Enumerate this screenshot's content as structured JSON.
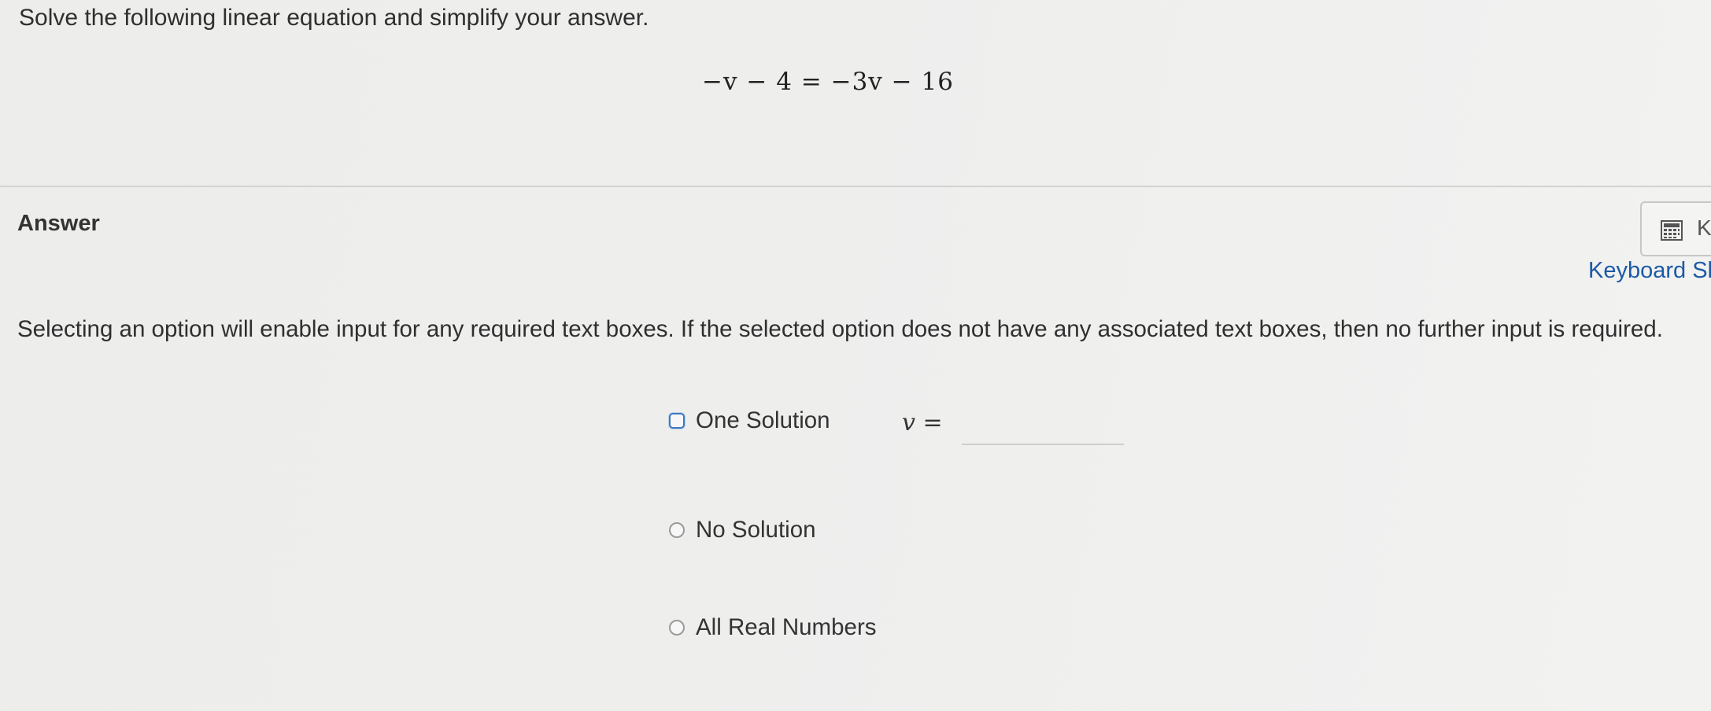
{
  "question": {
    "prompt": "Solve the following linear equation and simplify your answer.",
    "equation": "−v − 4 = −3v − 16"
  },
  "answer_section": {
    "heading": "Answer",
    "keyboard_button_letter": "K",
    "keyboard_shortcuts_label": "Keyboard Sh",
    "instructions": "Selecting an option will enable input for any required text boxes. If the selected option does not have any associated text boxes, then no further input is required."
  },
  "options": [
    {
      "label": "One Solution",
      "selected": false,
      "focused": true
    },
    {
      "label": "No Solution",
      "selected": false,
      "focused": false
    },
    {
      "label": "All Real Numbers",
      "selected": false,
      "focused": false
    }
  ],
  "solution_input": {
    "variable": "v",
    "equals": "=",
    "value": ""
  },
  "colors": {
    "link": "#1c5aa6",
    "focus_ring": "#3d78c2"
  },
  "icons": {
    "keyboard_button": "calculator-keyboard-icon"
  }
}
